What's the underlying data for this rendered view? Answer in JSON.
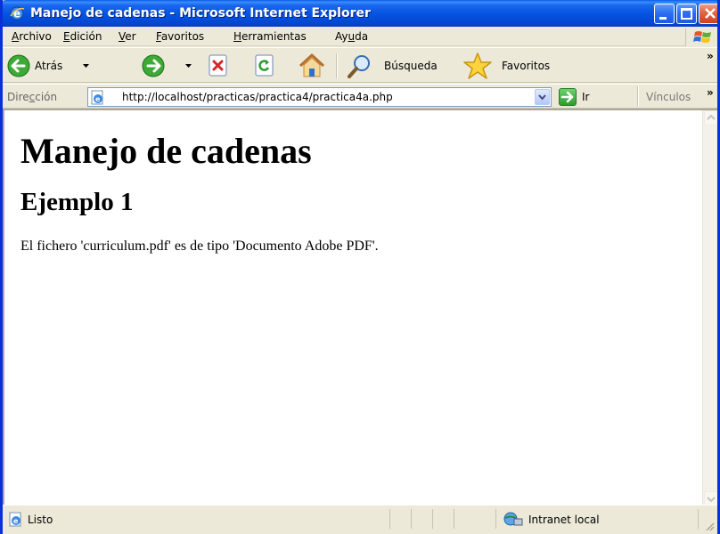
{
  "window": {
    "title": "Manejo de cadenas - Microsoft Internet Explorer"
  },
  "menu": {
    "items": [
      "Archivo",
      "Edición",
      "Ver",
      "Favoritos",
      "Herramientas",
      "Ayuda"
    ],
    "mnemonics": [
      "A",
      "E",
      "V",
      "F",
      "H",
      "u"
    ]
  },
  "toolbar": {
    "back_label": "Atrás",
    "search_label": "Búsqueda",
    "favorites_label": "Favoritos",
    "overflow": "»"
  },
  "address_bar": {
    "label": "Dirección",
    "url": "http://localhost/practicas/practica4/practica4a.php",
    "go_label": "Ir",
    "links_label": "Vínculos",
    "overflow": "»"
  },
  "page": {
    "heading": "Manejo de cadenas",
    "subheading": "Ejemplo 1",
    "paragraph": "El fichero 'curriculum.pdf' es de tipo 'Documento Adobe PDF'."
  },
  "status_bar": {
    "status_text": "Listo",
    "zone_text": "Intranet local"
  },
  "colors": {
    "title_bar": "#0453E0",
    "chrome": "#ECE9D8",
    "frame": "#0831D9"
  }
}
